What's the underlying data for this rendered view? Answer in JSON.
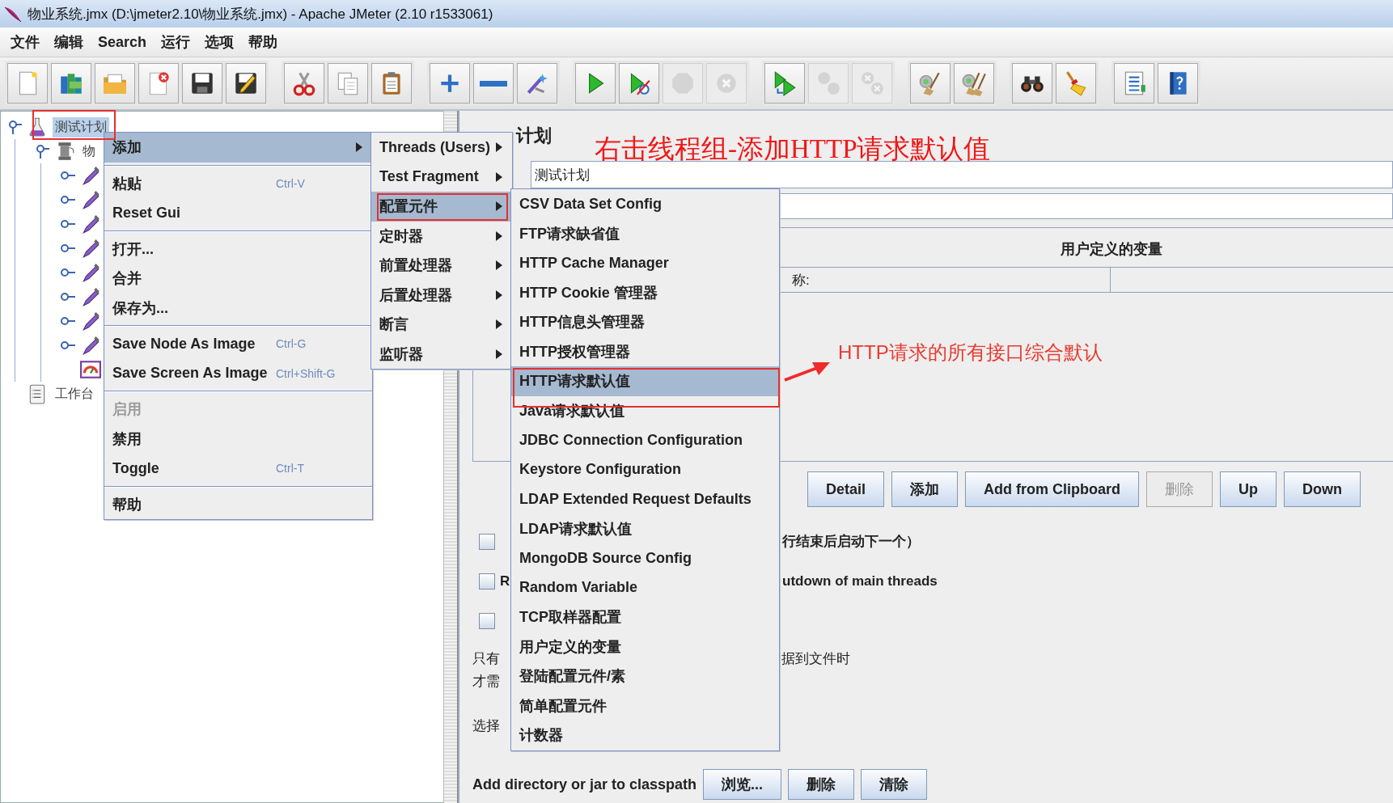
{
  "window": {
    "title": "物业系统.jmx (D:\\jmeter2.10\\物业系统.jmx) - Apache JMeter (2.10 r1533061)"
  },
  "menu_bar": [
    "文件",
    "编辑",
    "Search",
    "运行",
    "选项",
    "帮助"
  ],
  "toolbar": [
    [
      {
        "kind": "new",
        "disabled": false
      },
      {
        "kind": "templates",
        "disabled": false
      },
      {
        "kind": "open",
        "disabled": false
      },
      {
        "kind": "close",
        "disabled": false
      },
      {
        "kind": "save",
        "disabled": false
      },
      {
        "kind": "save_as",
        "disabled": false
      }
    ],
    [
      {
        "kind": "cut",
        "disabled": false
      },
      {
        "kind": "copy",
        "disabled": false
      },
      {
        "kind": "paste",
        "disabled": false
      }
    ],
    [
      {
        "kind": "expand",
        "disabled": false
      },
      {
        "kind": "collapse",
        "disabled": false
      },
      {
        "kind": "toggle",
        "disabled": false
      }
    ],
    [
      {
        "kind": "start",
        "disabled": false
      },
      {
        "kind": "start_no_pause",
        "disabled": false
      },
      {
        "kind": "stop",
        "disabled": true
      },
      {
        "kind": "shutdown",
        "disabled": true
      }
    ],
    [
      {
        "kind": "remote_start",
        "disabled": false
      },
      {
        "kind": "remote_stop",
        "disabled": true
      },
      {
        "kind": "remote_shutdown",
        "disabled": true
      }
    ],
    [
      {
        "kind": "clear",
        "disabled": false
      },
      {
        "kind": "clear_all",
        "disabled": false
      }
    ],
    [
      {
        "kind": "search",
        "disabled": false
      },
      {
        "kind": "reset_search",
        "disabled": false
      }
    ],
    [
      {
        "kind": "functions",
        "disabled": false
      },
      {
        "kind": "help",
        "disabled": false
      }
    ]
  ],
  "tree": [
    {
      "kind": "test_plan",
      "label": "测试计划",
      "selected": true,
      "expanded": true,
      "children": [
        {
          "kind": "thread_group",
          "label": "物",
          "selected": false,
          "expanded": true,
          "children": [
            {
              "kind": "sampler",
              "expanded": false
            },
            {
              "kind": "sampler",
              "expanded": false
            },
            {
              "kind": "sampler",
              "expanded": false
            },
            {
              "kind": "sampler",
              "expanded": false
            },
            {
              "kind": "sampler",
              "expanded": false
            },
            {
              "kind": "sampler",
              "expanded": false
            },
            {
              "kind": "sampler",
              "expanded": false
            },
            {
              "kind": "sampler",
              "expanded": false
            },
            {
              "kind": "listener"
            }
          ]
        }
      ]
    },
    {
      "kind": "workbench",
      "label": "工作台",
      "selected": false
    }
  ],
  "test_plan_panel": {
    "heading": "计划",
    "name_value": "测试计划",
    "variables_table": {
      "title": "用户定义的变量",
      "columns": [
        "称:"
      ]
    },
    "buttons": [
      {
        "label": "Detail",
        "disabled": false
      },
      {
        "label": "添加",
        "disabled": false
      },
      {
        "label": "Add from Clipboard",
        "disabled": false
      },
      {
        "label": "删除",
        "disabled": true
      },
      {
        "label": "Up",
        "disabled": false
      },
      {
        "label": "Down",
        "disabled": false
      }
    ],
    "options": [
      {
        "checked": false,
        "label_end": "行结束后启动下一个）"
      },
      {
        "checked": false,
        "label_start": "R",
        "label_end": "utdown of main threads"
      },
      {
        "checked": false
      }
    ],
    "note_lines": [
      {
        "start": "只有",
        "end": "据到文件时"
      },
      {
        "start": "才需"
      }
    ],
    "select_label": "选择",
    "classpath": {
      "label": "Add directory or jar to classpath",
      "buttons": [
        "浏览...",
        "删除",
        "清除"
      ]
    }
  },
  "context_menu": {
    "items": [
      {
        "kind": "item",
        "label": "添加",
        "selected": true,
        "disabled": false,
        "has_submenu": true
      },
      {
        "kind": "separator"
      },
      {
        "kind": "item",
        "label": "粘贴",
        "shortcut": "Ctrl-V",
        "selected": false,
        "disabled": false,
        "has_submenu": false
      },
      {
        "kind": "item",
        "label": "Reset Gui",
        "selected": false,
        "disabled": false,
        "has_submenu": false
      },
      {
        "kind": "separator"
      },
      {
        "kind": "item",
        "label": "打开...",
        "selected": false,
        "disabled": false,
        "has_submenu": false
      },
      {
        "kind": "item",
        "label": "合并",
        "selected": false,
        "disabled": false,
        "has_submenu": false
      },
      {
        "kind": "item",
        "label": "保存为...",
        "selected": false,
        "disabled": false,
        "has_submenu": false
      },
      {
        "kind": "separator"
      },
      {
        "kind": "item",
        "label": "Save Node As Image",
        "shortcut": "Ctrl-G",
        "selected": false,
        "disabled": false,
        "has_submenu": false
      },
      {
        "kind": "item",
        "label": "Save Screen As Image",
        "shortcut": "Ctrl+Shift-G",
        "selected": false,
        "disabled": false,
        "has_submenu": false
      },
      {
        "kind": "separator"
      },
      {
        "kind": "item",
        "label": "启用",
        "selected": false,
        "disabled": true,
        "has_submenu": false
      },
      {
        "kind": "item",
        "label": "禁用",
        "selected": false,
        "disabled": false,
        "has_submenu": false
      },
      {
        "kind": "item",
        "label": "Toggle",
        "shortcut": "Ctrl-T",
        "selected": false,
        "disabled": false,
        "has_submenu": false
      },
      {
        "kind": "separator"
      },
      {
        "kind": "item",
        "label": "帮助",
        "selected": false,
        "disabled": false,
        "has_submenu": false
      }
    ]
  },
  "add_submenu": {
    "items": [
      {
        "kind": "item",
        "label": "Threads (Users)",
        "selected": false,
        "disabled": false,
        "has_submenu": true
      },
      {
        "kind": "item",
        "label": "Test Fragment",
        "selected": false,
        "disabled": false,
        "has_submenu": true
      },
      {
        "kind": "item",
        "label": "配置元件",
        "selected": true,
        "disabled": false,
        "has_submenu": true
      },
      {
        "kind": "item",
        "label": "定时器",
        "selected": false,
        "disabled": false,
        "has_submenu": true
      },
      {
        "kind": "item",
        "label": "前置处理器",
        "selected": false,
        "disabled": false,
        "has_submenu": true
      },
      {
        "kind": "item",
        "label": "后置处理器",
        "selected": false,
        "disabled": false,
        "has_submenu": true
      },
      {
        "kind": "item",
        "label": "断言",
        "selected": false,
        "disabled": false,
        "has_submenu": true
      },
      {
        "kind": "item",
        "label": "监听器",
        "selected": false,
        "disabled": false,
        "has_submenu": true
      }
    ]
  },
  "config_submenu": {
    "items": [
      {
        "kind": "item",
        "label": "CSV Data Set Config",
        "selected": false,
        "disabled": false,
        "has_submenu": false
      },
      {
        "kind": "item",
        "label": "FTP请求缺省值",
        "selected": false,
        "disabled": false,
        "has_submenu": false
      },
      {
        "kind": "item",
        "label": "HTTP Cache Manager",
        "selected": false,
        "disabled": false,
        "has_submenu": false
      },
      {
        "kind": "item",
        "label": "HTTP Cookie 管理器",
        "selected": false,
        "disabled": false,
        "has_submenu": false
      },
      {
        "kind": "item",
        "label": "HTTP信息头管理器",
        "selected": false,
        "disabled": false,
        "has_submenu": false
      },
      {
        "kind": "item",
        "label": "HTTP授权管理器",
        "selected": false,
        "disabled": false,
        "has_submenu": false
      },
      {
        "kind": "item",
        "label": "HTTP请求默认值",
        "selected": true,
        "disabled": false,
        "has_submenu": false
      },
      {
        "kind": "item",
        "label": "Java请求默认值",
        "selected": false,
        "disabled": false,
        "has_submenu": false
      },
      {
        "kind": "item",
        "label": "JDBC Connection Configuration",
        "selected": false,
        "disabled": false,
        "has_submenu": false
      },
      {
        "kind": "item",
        "label": "Keystore Configuration",
        "selected": false,
        "disabled": false,
        "has_submenu": false
      },
      {
        "kind": "item",
        "label": "LDAP Extended Request Defaults",
        "selected": false,
        "disabled": false,
        "has_submenu": false
      },
      {
        "kind": "item",
        "label": "LDAP请求默认值",
        "selected": false,
        "disabled": false,
        "has_submenu": false
      },
      {
        "kind": "item",
        "label": "MongoDB Source Config",
        "selected": false,
        "disabled": false,
        "has_submenu": false
      },
      {
        "kind": "item",
        "label": "Random Variable",
        "selected": false,
        "disabled": false,
        "has_submenu": false
      },
      {
        "kind": "item",
        "label": "TCP取样器配置",
        "selected": false,
        "disabled": false,
        "has_submenu": false
      },
      {
        "kind": "item",
        "label": "用户定义的变量",
        "selected": false,
        "disabled": false,
        "has_submenu": false
      },
      {
        "kind": "item",
        "label": "登陆配置元件/素",
        "selected": false,
        "disabled": false,
        "has_submenu": false
      },
      {
        "kind": "item",
        "label": "简单配置元件",
        "selected": false,
        "disabled": false,
        "has_submenu": false
      },
      {
        "kind": "item",
        "label": "计数器",
        "selected": false,
        "disabled": false,
        "has_submenu": false
      }
    ]
  },
  "annotations": [
    {
      "kind": "title",
      "text": "右击线程组-添加HTTP请求默认值"
    },
    {
      "kind": "note",
      "text": "HTTP请求的所有接口综合默认"
    }
  ]
}
